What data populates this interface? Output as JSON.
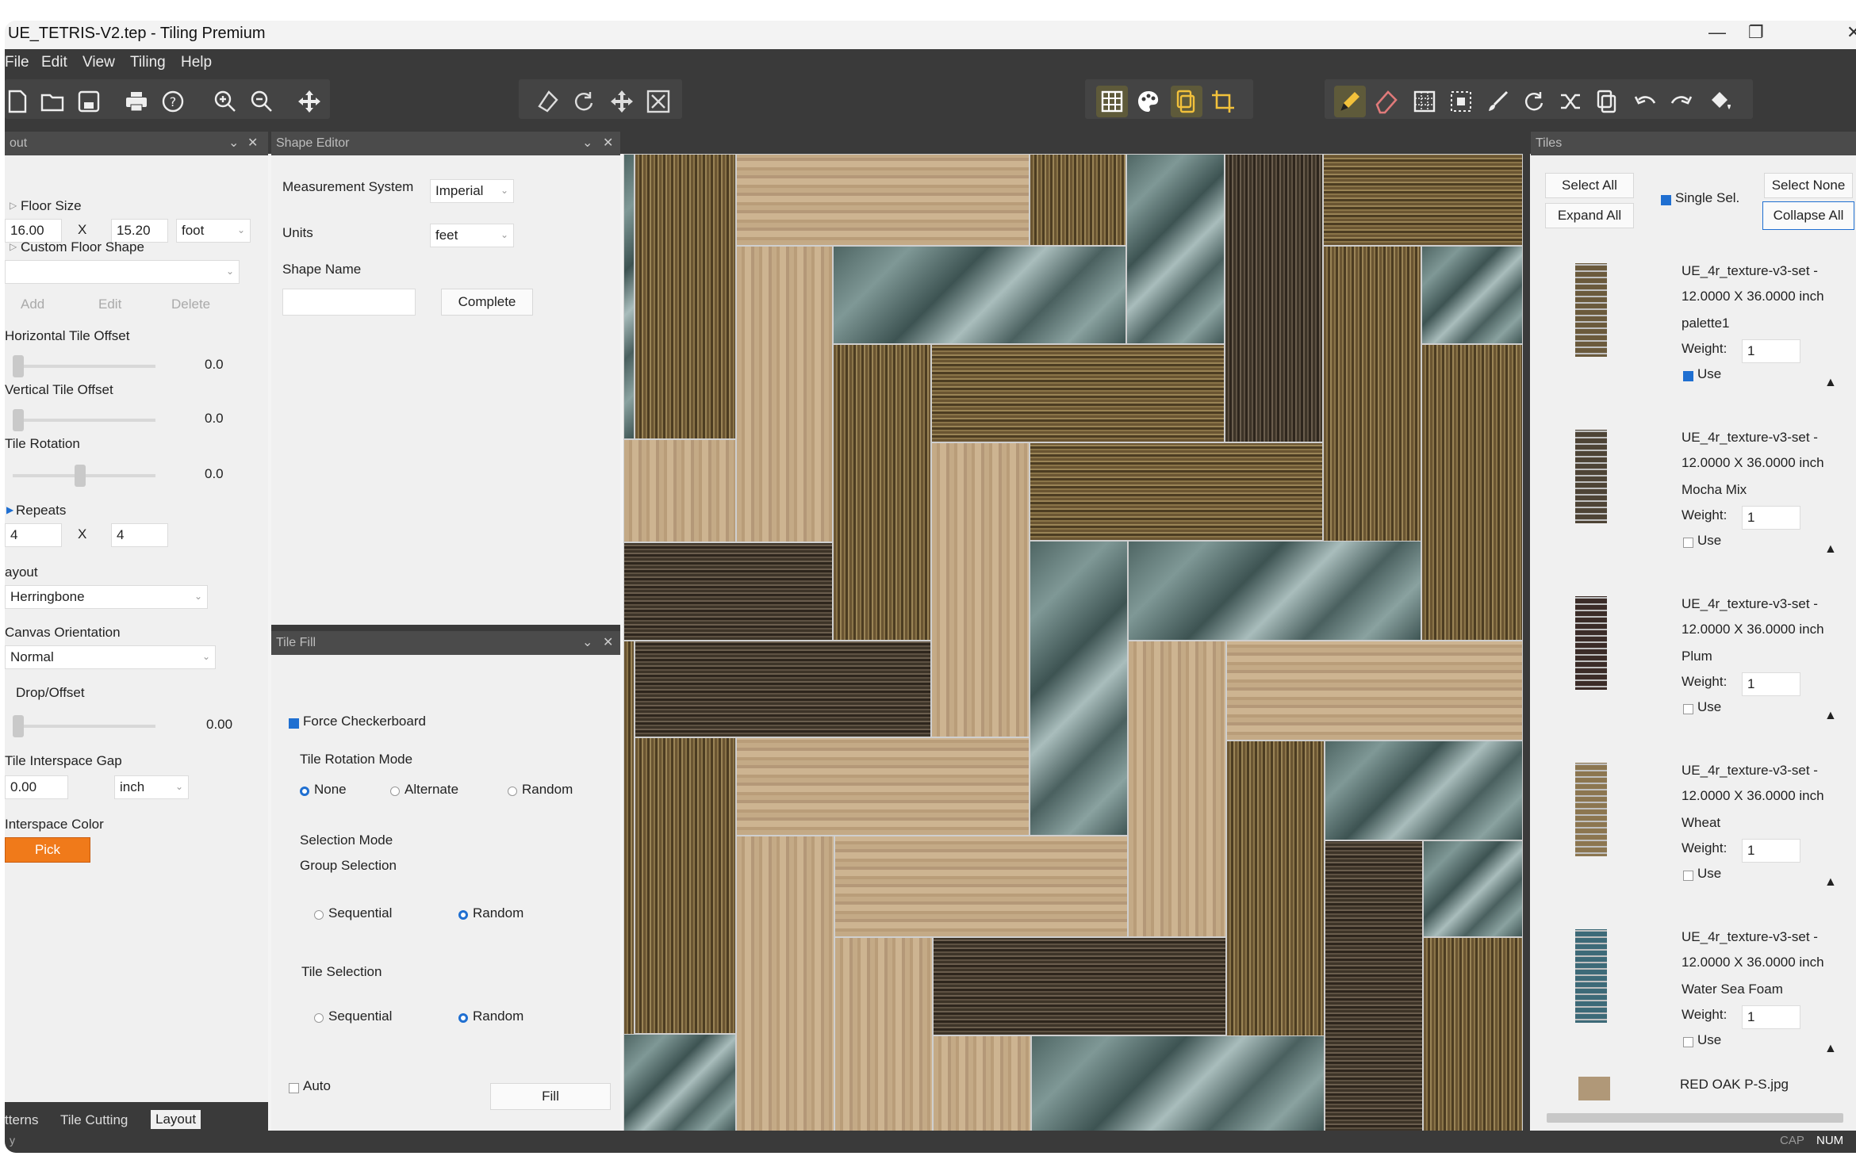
{
  "window": {
    "title": "UE_TETRIS-V2.tep - Tiling Premium",
    "controls": [
      "minimize-icon",
      "restore-icon",
      "close-icon"
    ]
  },
  "menu": [
    "File",
    "Edit",
    "View",
    "Tiling",
    "Help"
  ],
  "toolbar": {
    "group1": [
      "new-file-icon",
      "open-folder-icon",
      "save-icon",
      "print-icon",
      "help-icon",
      "zoom-in-icon",
      "zoom-out-icon",
      "move-icon"
    ],
    "group2": [
      "select-shape-icon",
      "rotate-icon",
      "pan-icon",
      "fit-icon"
    ],
    "group3": [
      "grid-icon",
      "palette-icon",
      "copy-icon",
      "crop-icon"
    ],
    "group4": [
      "pencil-icon",
      "eraser-icon",
      "pattern-icon",
      "selection-icon",
      "brush-icon",
      "redo-rotate-icon",
      "shuffle-icon",
      "duplicate-icon",
      "undo-icon",
      "redo-icon",
      "fill-bucket-icon"
    ]
  },
  "layout_panel": {
    "title": "out",
    "floor_size_label": "Floor Size",
    "floor_width": "16.00",
    "x1": "X",
    "floor_height": "15.20",
    "floor_unit": "foot",
    "custom_shape_label": "Custom Floor Shape",
    "custom_shape_value": "",
    "add": "Add",
    "edit": "Edit",
    "delete": "Delete",
    "h_offset_label": "Horizontal Tile Offset",
    "h_offset_value": "0.0",
    "v_offset_label": "Vertical Tile Offset",
    "v_offset_value": "0.0",
    "rotation_label": "Tile Rotation",
    "rotation_value": "0.0",
    "repeats_label": "Repeats",
    "repeats_x": "4",
    "x2": "X",
    "repeats_y": "4",
    "layout_label": "ayout",
    "layout_value": "Herringbone",
    "orientation_label": "Canvas Orientation",
    "orientation_value": "Normal",
    "drop_label": "Drop/Offset",
    "drop_value": "0.00",
    "gap_label": "Tile Interspace Gap",
    "gap_value": "0.00",
    "gap_unit": "inch",
    "color_label": "Interspace Color",
    "pick": "Pick",
    "pick_color": "#f07a1a"
  },
  "bottom_tabs": [
    "tterns",
    "Tile Cutting",
    "Layout"
  ],
  "shape_editor": {
    "title": "Shape Editor",
    "measurement_label": "Measurement System",
    "measurement_value": "Imperial",
    "units_label": "Units",
    "units_value": "feet",
    "shape_name_label": "Shape Name",
    "shape_name_value": "",
    "complete": "Complete"
  },
  "tile_fill": {
    "title": "Tile Fill",
    "force_checkerboard": "Force Checkerboard",
    "rotation_mode_label": "Tile Rotation Mode",
    "none": "None",
    "alternate": "Alternate",
    "random": "Random",
    "selection_mode_label": "Selection Mode",
    "group_selection_label": "Group Selection",
    "group_sequential": "Sequential",
    "group_random": "Random",
    "tile_selection_label": "Tile Selection",
    "tile_sequential": "Sequential",
    "tile_random": "Random",
    "auto": "Auto",
    "fill": "Fill"
  },
  "tiles_panel": {
    "title": "Tiles",
    "select_all": "Select All",
    "select_none": "Select None",
    "expand_all": "Expand All",
    "collapse_all": "Collapse All",
    "single_sel": "Single Sel.",
    "weight_label": "Weight:",
    "use_label": "Use",
    "items": [
      {
        "line1": "UE_4r_texture-v3-set -",
        "size": "12.0000 X 36.0000 inch",
        "name": "palette1",
        "weight": "1",
        "use": true,
        "color": "#6b5a3c"
      },
      {
        "line1": "UE_4r_texture-v3-set -",
        "size": "12.0000 X 36.0000 inch",
        "name": "Mocha Mix",
        "weight": "1",
        "use": false,
        "color": "#4e4436"
      },
      {
        "line1": "UE_4r_texture-v3-set -",
        "size": "12.0000 X 36.0000 inch",
        "name": "Plum",
        "weight": "1",
        "use": false,
        "color": "#3b2c28"
      },
      {
        "line1": "UE_4r_texture-v3-set -",
        "size": "12.0000 X 36.0000 inch",
        "name": "Wheat",
        "weight": "1",
        "use": false,
        "color": "#8c7650"
      },
      {
        "line1": "UE_4r_texture-v3-set -",
        "size": "12.0000 X 36.0000 inch",
        "name": "Water Sea Foam",
        "weight": "1",
        "use": false,
        "color": "#3d6a78"
      }
    ],
    "last_item": "RED OAK P-S.jpg"
  },
  "status": {
    "left": "y",
    "cap": "CAP",
    "num": "NUM"
  }
}
